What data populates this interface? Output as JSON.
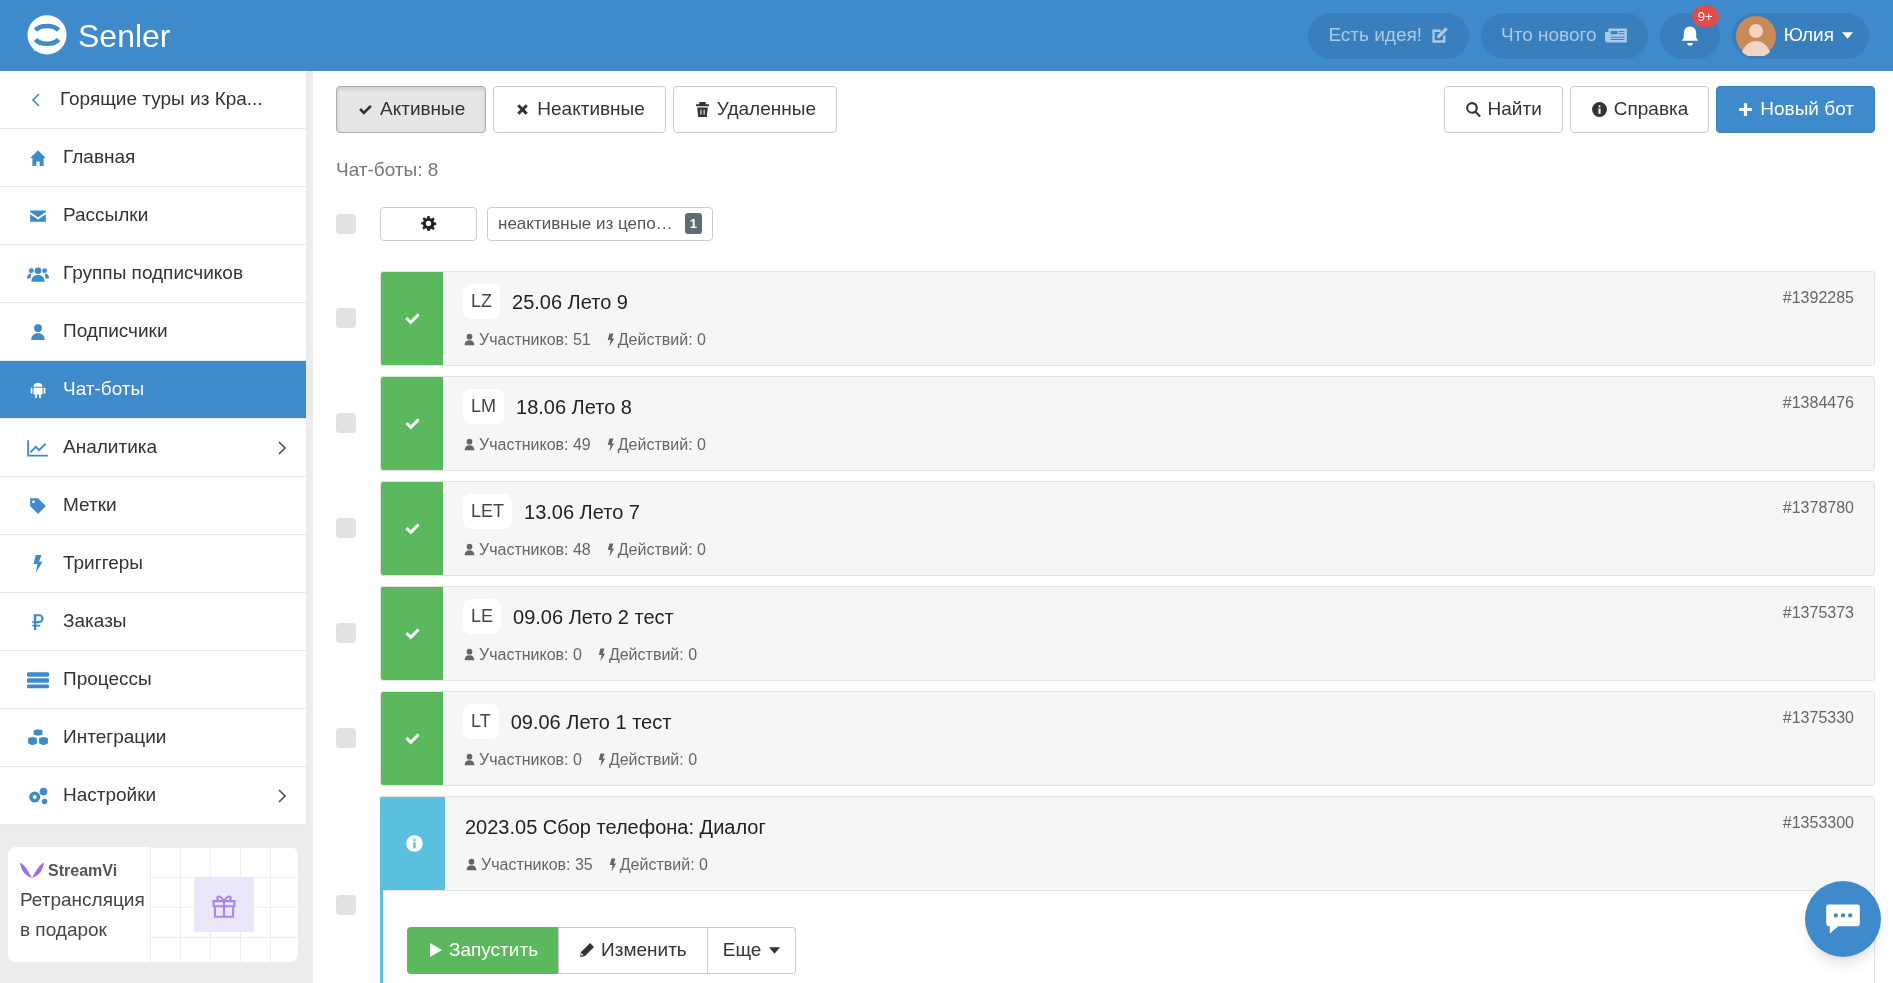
{
  "header": {
    "logo": "Senler",
    "idea_button": "Есть идея!",
    "news_button": "Что нового",
    "notification_badge": "9+",
    "user_name": "Юлия"
  },
  "sidebar": {
    "back_item": "Горящие туры из Кра...",
    "items": [
      {
        "label": "Главная",
        "selected": false,
        "has_submenu": false
      },
      {
        "label": "Рассылки",
        "selected": false,
        "has_submenu": false
      },
      {
        "label": "Группы подписчиков",
        "selected": false,
        "has_submenu": false
      },
      {
        "label": "Подписчики",
        "selected": false,
        "has_submenu": false
      },
      {
        "label": "Чат-боты",
        "selected": true,
        "has_submenu": false
      },
      {
        "label": "Аналитика",
        "selected": false,
        "has_submenu": true
      },
      {
        "label": "Метки",
        "selected": false,
        "has_submenu": false
      },
      {
        "label": "Триггеры",
        "selected": false,
        "has_submenu": false
      },
      {
        "label": "Заказы",
        "selected": false,
        "has_submenu": false
      },
      {
        "label": "Процессы",
        "selected": false,
        "has_submenu": false
      },
      {
        "label": "Интеграции",
        "selected": false,
        "has_submenu": false
      },
      {
        "label": "Настройки",
        "selected": false,
        "has_submenu": true
      }
    ],
    "promo": {
      "brand": "StreamVi",
      "text": "Ретрансляция в подарок"
    }
  },
  "tabs": [
    {
      "label": "Активные",
      "selected": true
    },
    {
      "label": "Неактивные",
      "selected": false
    },
    {
      "label": "Удаленные",
      "selected": false
    }
  ],
  "actions": {
    "find": "Найти",
    "help": "Справка",
    "new_bot": "Новый бот"
  },
  "count_label": "Чат-боты: 8",
  "select_all": {
    "checked": false
  },
  "filter": {
    "label": "неактивные из цепо…",
    "count": "1"
  },
  "bots": [
    {
      "kind": "active",
      "tag": "LZ",
      "title": "25.06 Лето 9",
      "participants": "Участников: 51",
      "actions": "Действий: 0",
      "id": "#1392285",
      "checked": false,
      "expanded": false
    },
    {
      "kind": "active",
      "tag": "LM",
      "title": "18.06 Лето 8",
      "participants": "Участников: 49",
      "actions": "Действий: 0",
      "id": "#1384476",
      "checked": false,
      "expanded": false
    },
    {
      "kind": "active",
      "tag": "LET",
      "title": "13.06 Лето 7",
      "participants": "Участников: 48",
      "actions": "Действий: 0",
      "id": "#1378780",
      "checked": false,
      "expanded": false
    },
    {
      "kind": "active",
      "tag": "LE",
      "title": "09.06 Лето 2 тест",
      "participants": "Участников: 0",
      "actions": "Действий: 0",
      "id": "#1375373",
      "checked": false,
      "expanded": false
    },
    {
      "kind": "active",
      "tag": "LT",
      "title": "09.06 Лето 1 тест",
      "participants": "Участников: 0",
      "actions": "Действий: 0",
      "id": "#1375330",
      "checked": false,
      "expanded": false
    },
    {
      "kind": "info",
      "title": "2023.05 Сбор телефона: Диалог",
      "participants": "Участников: 35",
      "actions": "Действий: 0",
      "id": "#1353300",
      "checked": false,
      "expanded": true,
      "buttons": {
        "run": "Запустить",
        "edit": "Изменить",
        "more": "Еще"
      }
    }
  ]
}
